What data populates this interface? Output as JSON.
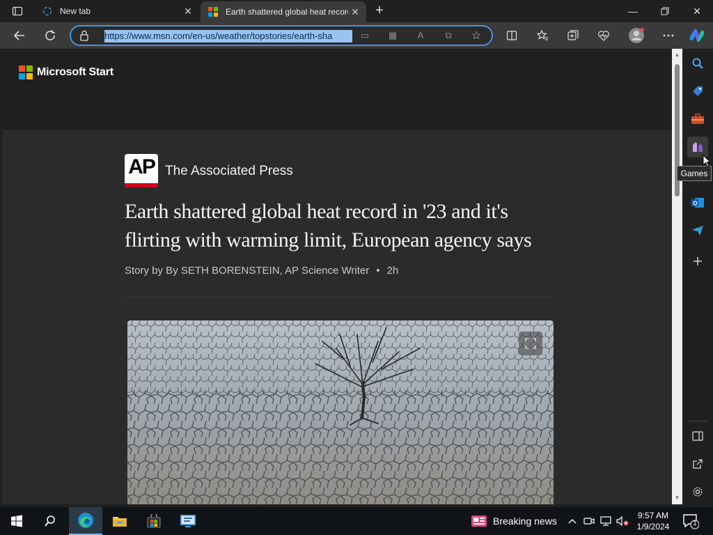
{
  "tabs": [
    {
      "title": "New tab",
      "active": false
    },
    {
      "title": "Earth shattered global heat record",
      "active": true
    }
  ],
  "toolbar": {
    "url": "https://www.msn.com/en-us/weather/topstories/earth-sha"
  },
  "site": {
    "brand": "Microsoft Start",
    "logo_colors": [
      "#f25022",
      "#7fba00",
      "#00a4ef",
      "#ffb900"
    ]
  },
  "article": {
    "publisher_logo": "AP",
    "publisher": "The Associated Press",
    "headline": "Earth shattered global heat record in '23 and it's flirting with warming limit, European agency says",
    "byline": "Story by By SETH BORENSTEIN, AP Science Writer",
    "age": "2h",
    "separator": "•"
  },
  "sidebar": {
    "tooltip": "Games",
    "items": [
      "search-icon",
      "tag-icon",
      "toolbox-icon",
      "games-icon",
      "outlook-icon",
      "send-icon",
      "add-icon"
    ]
  },
  "taskbar": {
    "news_label": "Breaking news",
    "time": "9:57 AM",
    "date": "1/9/2024",
    "notification_count": "1"
  }
}
